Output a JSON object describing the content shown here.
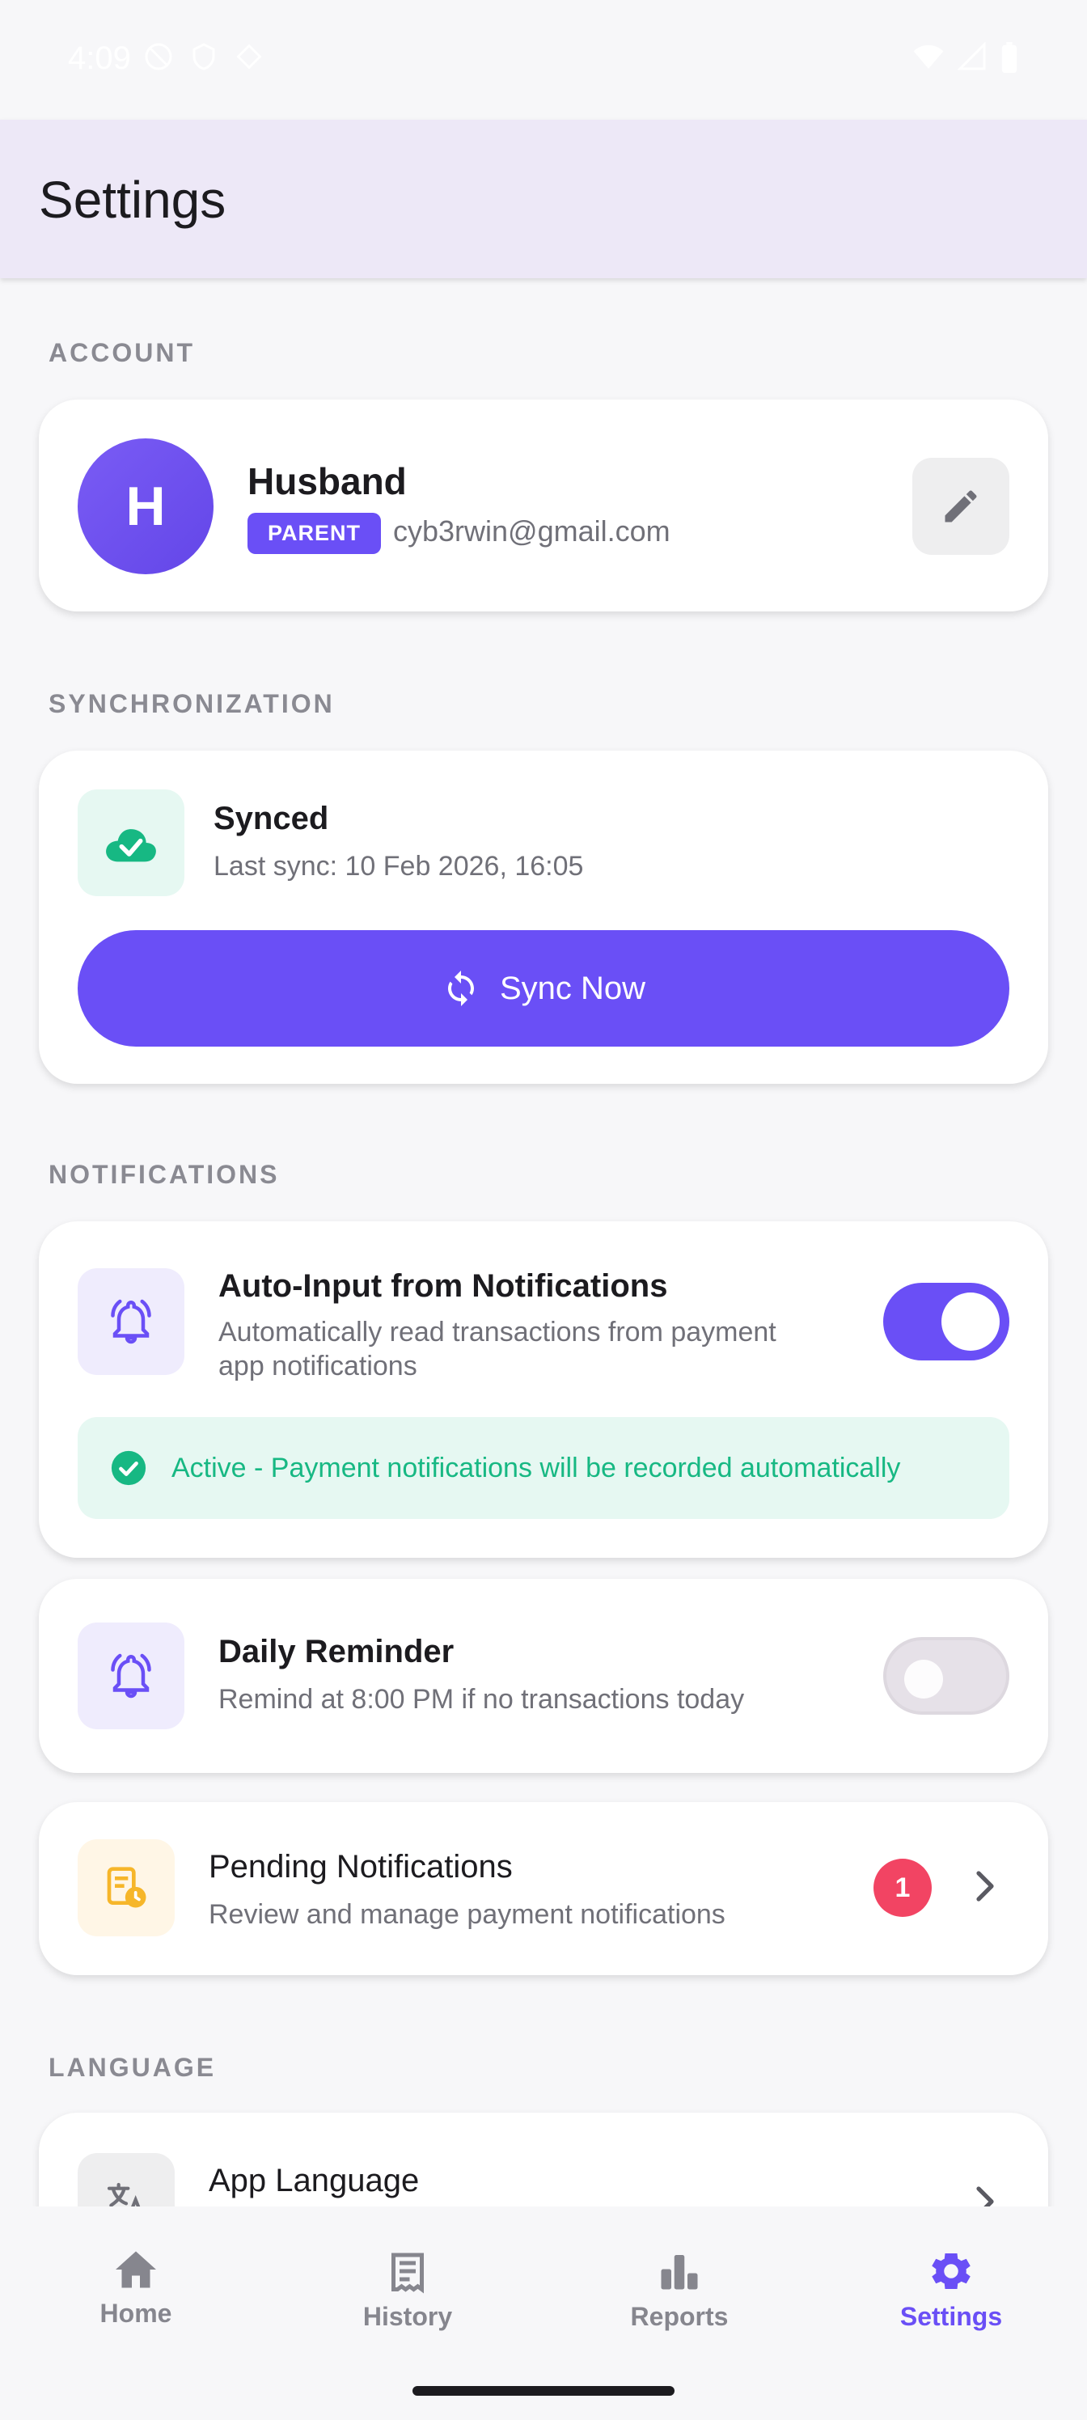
{
  "status_bar": {
    "time": "4:09"
  },
  "app_bar": {
    "title": "Settings"
  },
  "sections": {
    "account": "ACCOUNT",
    "sync": "SYNCHRONIZATION",
    "notifications": "NOTIFICATIONS",
    "language": "LANGUAGE"
  },
  "account": {
    "avatar_initial": "H",
    "name": "Husband",
    "role": "PARENT",
    "email": "cyb3rwin@gmail.com"
  },
  "sync": {
    "status": "Synced",
    "last_sync": "Last sync: 10 Feb 2026, 16:05",
    "button_label": "Sync Now"
  },
  "notifications": {
    "auto_input": {
      "title": "Auto-Input from Notifications",
      "subtitle_line1": "Automatically read transactions from payment",
      "subtitle_line2": "app notifications",
      "enabled": true,
      "active_message": "Active - Payment notifications will be recorded automatically"
    },
    "daily_reminder": {
      "title": "Daily Reminder",
      "subtitle": "Remind at 8:00 PM if no transactions today",
      "enabled": false
    },
    "pending": {
      "title": "Pending Notifications",
      "subtitle": "Review and manage payment notifications",
      "count": "1"
    }
  },
  "language": {
    "title": "App Language"
  },
  "bottom_nav": {
    "items": [
      {
        "label": "Home",
        "icon": "home-icon"
      },
      {
        "label": "History",
        "icon": "receipt-icon"
      },
      {
        "label": "Reports",
        "icon": "bar-chart-icon"
      },
      {
        "label": "Settings",
        "icon": "gear-icon",
        "active": true
      }
    ]
  },
  "colors": {
    "accent": "#6a4ff6",
    "success": "#17b883",
    "badge": "#f24463"
  }
}
